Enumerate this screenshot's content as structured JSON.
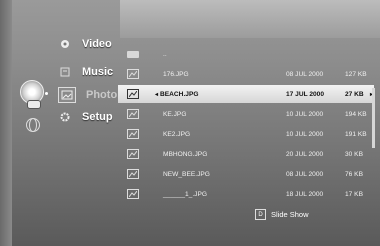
{
  "menu": {
    "items": [
      {
        "label": "Video",
        "icon": "film-reel-icon"
      },
      {
        "label": "Music",
        "icon": "music-notes-icon"
      },
      {
        "label": "Photo",
        "icon": "photo-icon"
      },
      {
        "label": "Setup",
        "icon": "gear-icon"
      }
    ],
    "active_index": 2
  },
  "file_list": {
    "parent_label": "..",
    "files": [
      {
        "name": "176.JPG",
        "date": "08 JUL 2000",
        "size": "127 KB"
      },
      {
        "name": "BEACH.JPG",
        "date": "17 JUL 2000",
        "size": "27 KB",
        "selected": true
      },
      {
        "name": "KE.JPG",
        "date": "10 JUL 2000",
        "size": "194 KB"
      },
      {
        "name": "KE2.JPG",
        "date": "10 JUL 2000",
        "size": "191 KB"
      },
      {
        "name": "MBHONG.JPG",
        "date": "20 JUL 2000",
        "size": "30 KB"
      },
      {
        "name": "NEW_BEE.JPG",
        "date": "08 JUL 2000",
        "size": "76 KB"
      },
      {
        "name": "______1_.JPG",
        "date": "18 JUL 2000",
        "size": "17 KB"
      }
    ]
  },
  "footer": {
    "key_label": "D",
    "action_label": "Slide Show"
  },
  "colors": {
    "selection": "#e8e8e8",
    "text": "#f0f0f0",
    "background": "#8a8a8a"
  }
}
